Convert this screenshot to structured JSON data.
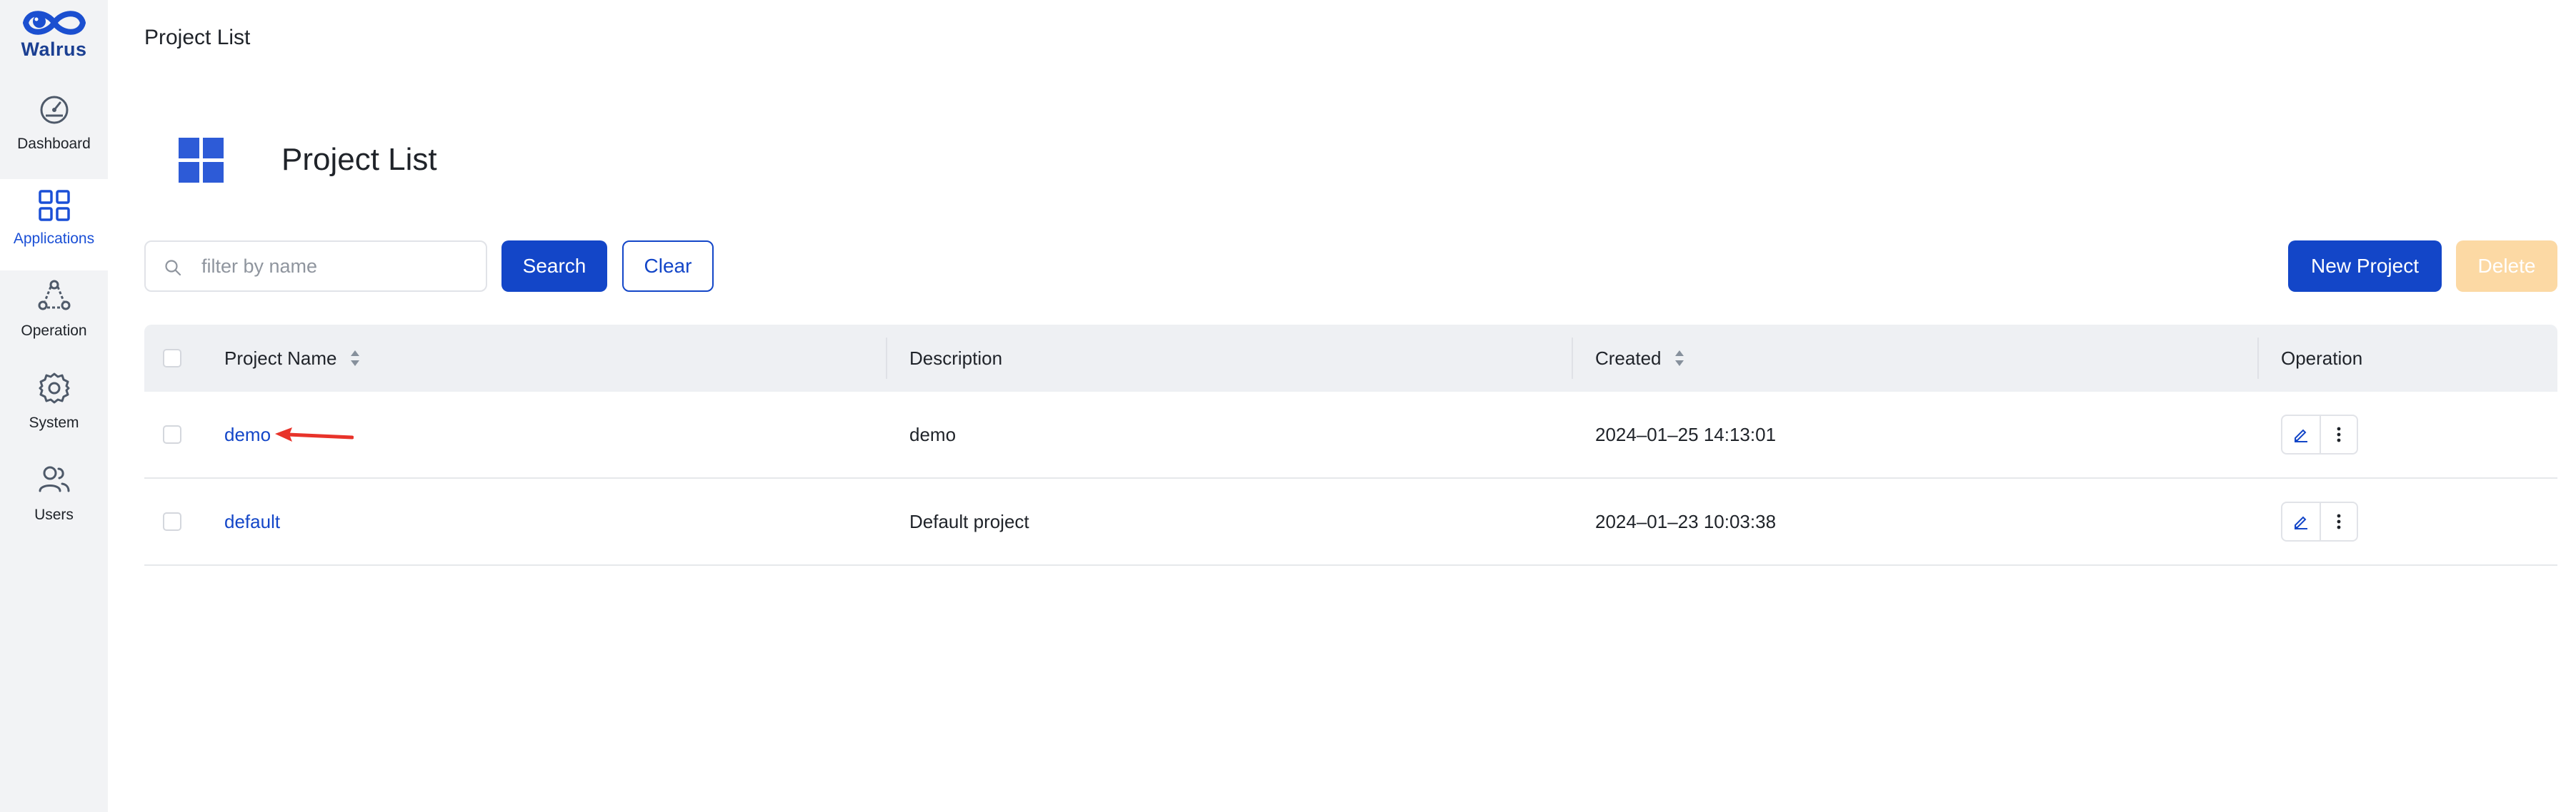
{
  "brand": {
    "name": "Walrus"
  },
  "sidebar": {
    "items": [
      {
        "label": "Dashboard",
        "icon": "dashboard-gauge-icon"
      },
      {
        "label": "Applications",
        "icon": "grid-icon",
        "active": true
      },
      {
        "label": "Operation",
        "icon": "operation-nodes-icon"
      },
      {
        "label": "System",
        "icon": "gear-icon"
      },
      {
        "label": "Users",
        "icon": "users-icon"
      }
    ]
  },
  "topbar": {
    "title": "Project List"
  },
  "page": {
    "title": "Project List"
  },
  "toolbar": {
    "search_placeholder": "filter by name",
    "search_value": "",
    "search_label": "Search",
    "clear_label": "Clear",
    "new_project_label": "New Project",
    "delete_label": "Delete"
  },
  "table": {
    "headers": {
      "name": "Project Name",
      "description": "Description",
      "created": "Created",
      "operation": "Operation"
    },
    "rows": [
      {
        "name": "demo",
        "description": "demo",
        "created": "2024–01–25 14:13:01"
      },
      {
        "name": "default",
        "description": "Default project",
        "created": "2024–01–23 10:03:38"
      }
    ]
  },
  "colors": {
    "accent": "#1346c8",
    "sidebar_bg": "#f2f3f5",
    "delete_disabled": "#fcd9a4",
    "annotation_arrow": "#e8332a"
  }
}
